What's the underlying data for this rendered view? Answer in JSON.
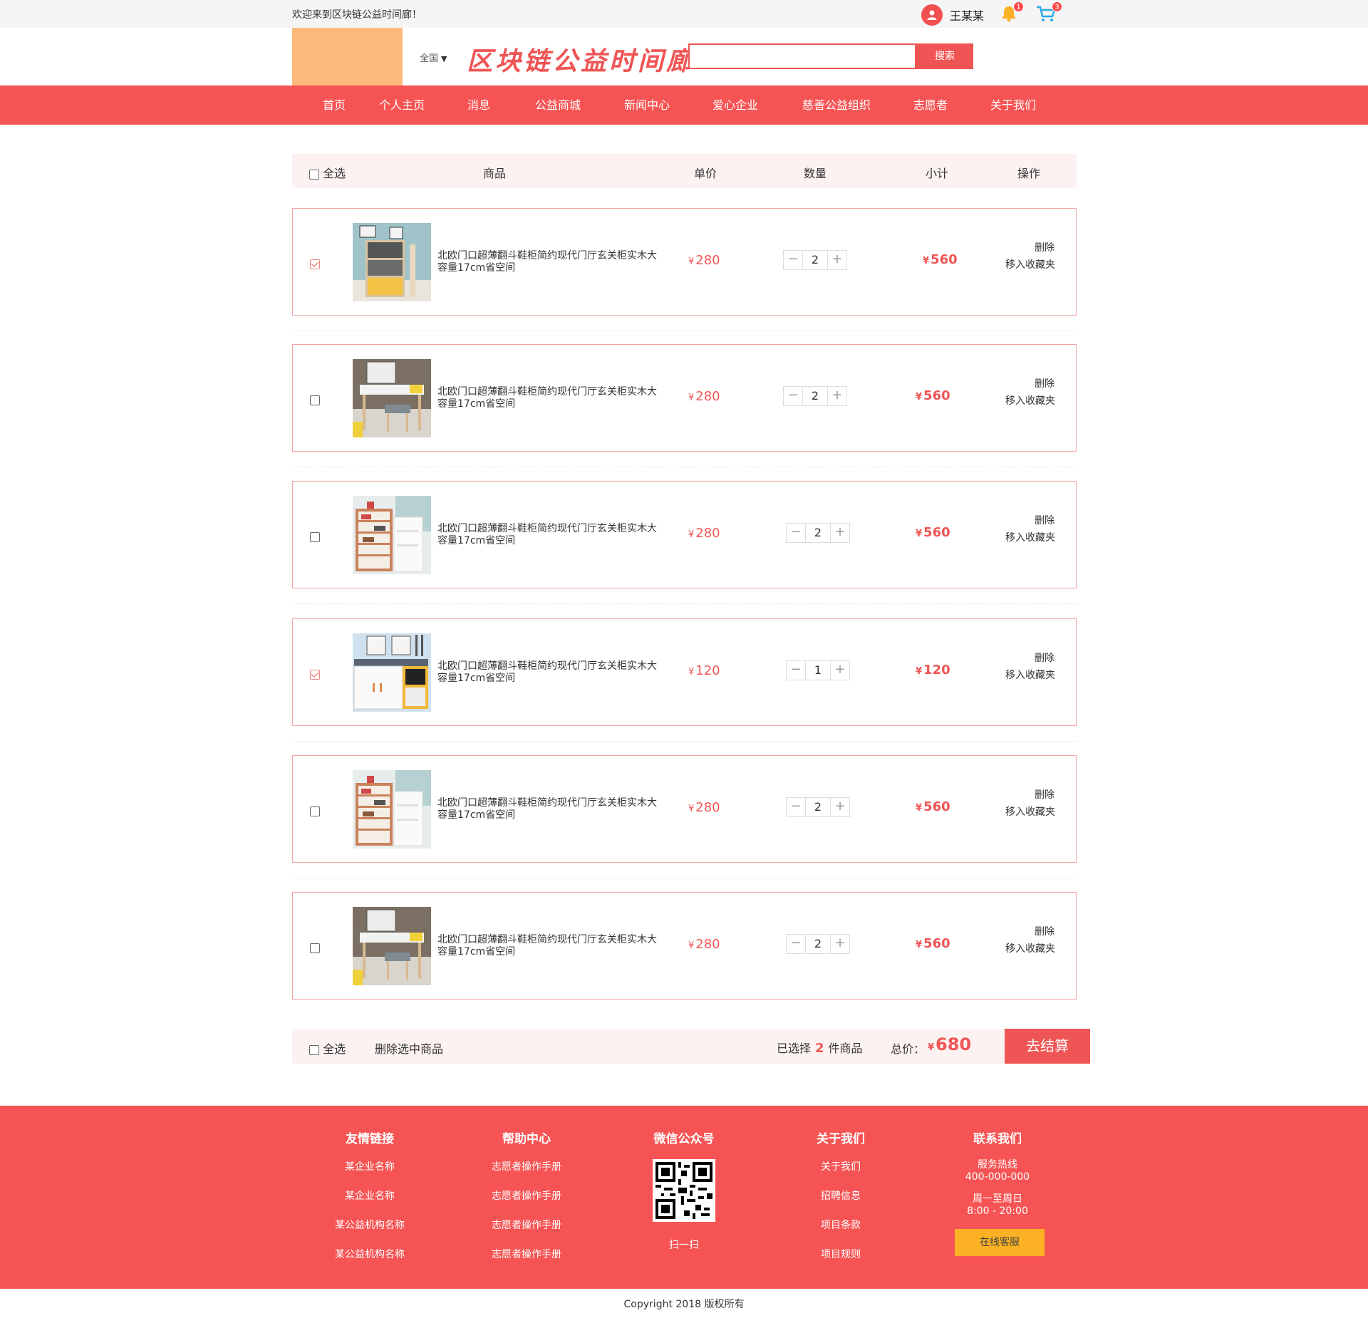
{
  "topbar": {
    "welcome": "欢迎来到区块链公益时间廊！",
    "user_name": "王某某",
    "notify_count": "1",
    "cart_count": "3"
  },
  "header": {
    "region": "全国",
    "brand": "区块链公益时间廊",
    "search_placeholder": "",
    "search_button": "搜索"
  },
  "nav": [
    "首页",
    "个人主页",
    "消息",
    "公益商城",
    "新闻中心",
    "爱心企业",
    "慈善公益组织",
    "志愿者",
    "关于我们"
  ],
  "table_header": {
    "select_all": "全选",
    "product": "商品",
    "unit_price": "单价",
    "quantity": "数量",
    "subtotal": "小计",
    "action": "操作"
  },
  "currency": "¥",
  "actions": {
    "delete": "删除",
    "favorite": "移入收藏夹"
  },
  "items": [
    {
      "checked": true,
      "image": "shoe-cabinet-flip",
      "desc": "北欧门口超薄翻斗鞋柜简约现代门厅玄关柜实木大容量17cm省空间",
      "price": "280",
      "qty": "2",
      "subtotal": "560"
    },
    {
      "checked": false,
      "image": "dresser-stool",
      "desc": "北欧门口超薄翻斗鞋柜简约现代门厅玄关柜实木大容量17cm省空间",
      "price": "280",
      "qty": "2",
      "subtotal": "560"
    },
    {
      "checked": false,
      "image": "shoe-rack-shelves",
      "desc": "北欧门口超薄翻斗鞋柜简约现代门厅玄关柜实木大容量17cm省空间",
      "price": "280",
      "qty": "2",
      "subtotal": "560"
    },
    {
      "checked": true,
      "image": "hall-bench-cabinet",
      "desc": "北欧门口超薄翻斗鞋柜简约现代门厅玄关柜实木大容量17cm省空间",
      "price": "120",
      "qty": "1",
      "subtotal": "120"
    },
    {
      "checked": false,
      "image": "shoe-rack-shelves",
      "desc": "北欧门口超薄翻斗鞋柜简约现代门厅玄关柜实木大容量17cm省空间",
      "price": "280",
      "qty": "2",
      "subtotal": "560"
    },
    {
      "checked": false,
      "image": "dresser-stool",
      "desc": "北欧门口超薄翻斗鞋柜简约现代门厅玄关柜实木大容量17cm省空间",
      "price": "280",
      "qty": "2",
      "subtotal": "560"
    }
  ],
  "bottom": {
    "select_all": "全选",
    "delete_selected": "删除选中商品",
    "selected_prefix": "已选择",
    "selected_count": "2",
    "selected_suffix": "件商品",
    "total_label": "总价：",
    "total": "680",
    "checkout": "去结算"
  },
  "footer": {
    "links": {
      "title": "友情链接",
      "items": [
        "某企业名称",
        "某企业名称",
        "某公益机构名称",
        "某公益机构名称"
      ]
    },
    "help": {
      "title": "帮助中心",
      "items": [
        "志愿者操作手册",
        "志愿者操作手册",
        "志愿者操作手册",
        "志愿者操作手册"
      ]
    },
    "wechat": {
      "title": "微信公众号",
      "scan": "扫一扫"
    },
    "about": {
      "title": "关于我们",
      "items": [
        "关于我们",
        "招聘信息",
        "项目条款",
        "项目规则"
      ]
    },
    "contact": {
      "title": "联系我们",
      "hotline_label": "服务热线",
      "hotline": "400-000-000",
      "hours_label": "周一至周日",
      "hours": "8:00 - 20:00",
      "service_button": "在线客服"
    },
    "copyright": "Copyright 2018 版权所有"
  },
  "colors": {
    "brand_red": "#f65454",
    "accent_red": "#f05555",
    "logo_orange": "#fdbb7b",
    "service_yellow": "#fbb123"
  }
}
